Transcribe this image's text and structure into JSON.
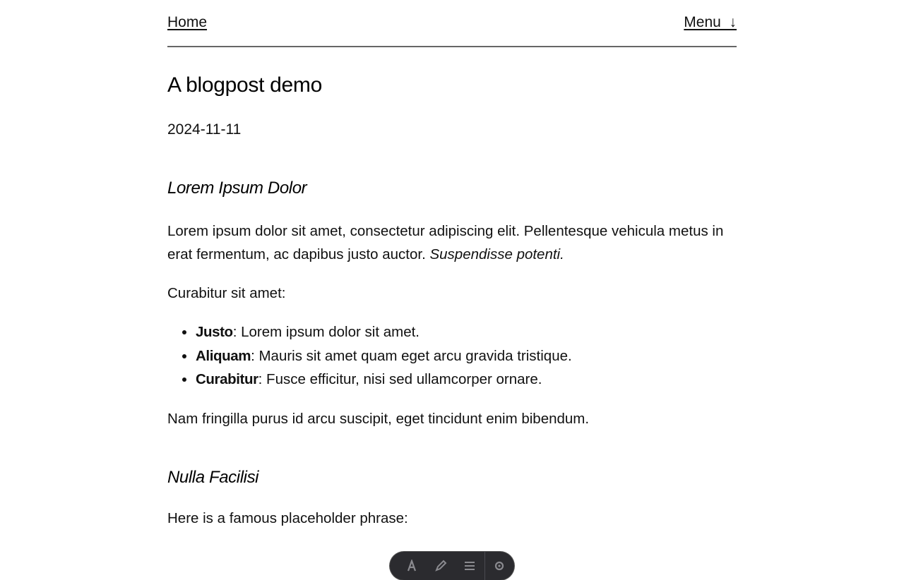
{
  "nav": {
    "home_label": "Home",
    "menu_label": "Menu  ↓"
  },
  "post": {
    "title": "A blogpost demo",
    "date": "2024-11-11"
  },
  "sections": [
    {
      "heading": "Lorem Ipsum Dolor",
      "intro_plain": "Lorem ipsum dolor sit amet, consectetur adipiscing elit. Pellentesque vehicula metus in erat fermentum, ac dapibus justo auctor. ",
      "intro_italic": "Suspendisse potenti.",
      "list_lead": "Curabitur sit amet:",
      "items": [
        {
          "term": "Justo",
          "text": ": Lorem ipsum dolor sit amet."
        },
        {
          "term": "Aliquam",
          "text": ": Mauris sit amet quam eget arcu gravida tristique."
        },
        {
          "term": "Curabitur",
          "text": ": Fusce efficitur, nisi sed ullamcorper ornare."
        }
      ],
      "closing": "Nam fringilla purus id arcu suscipit, eget tincidunt enim bibendum."
    },
    {
      "heading": "Nulla Facilisi",
      "intro": "Here is a famous placeholder phrase:"
    }
  ],
  "toolbar": {
    "icons": [
      "font-icon",
      "pen-icon",
      "lines-icon",
      "gear-icon"
    ]
  }
}
